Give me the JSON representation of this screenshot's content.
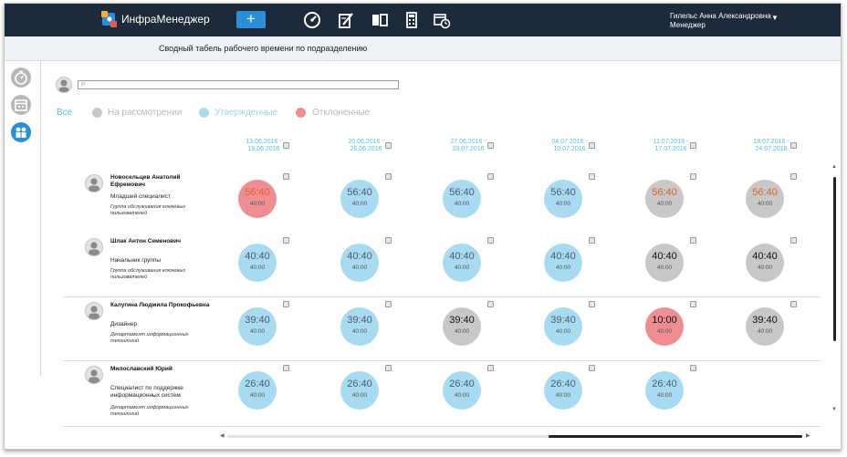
{
  "app": {
    "logo_text": "ИнфраМенеджер"
  },
  "header": {
    "add_label": "+",
    "nav_icons": [
      "dashboard-gauge-icon",
      "document-edit-icon",
      "book-icon",
      "calculator-icon",
      "calendar-clock-icon"
    ],
    "user": {
      "name": "Гилельс Анна Александровна",
      "role": "Менеджер",
      "caret": "▼"
    }
  },
  "page": {
    "title": "Сводный табель рабочего времени по подразделению"
  },
  "sidebar": {
    "icons": [
      "timer-icon",
      "calendar-icon",
      "team-icon"
    ]
  },
  "search": {
    "value": "P"
  },
  "filters": [
    {
      "label": "Все",
      "color": "#5bbde4"
    },
    {
      "label": "На рассмотрении",
      "color": "#c8c8c8"
    },
    {
      "label": "Утвержденные",
      "color": "#a8dbf2"
    },
    {
      "label": "Отклоненные",
      "color": "#ee8e93"
    }
  ],
  "periods": [
    {
      "start": "13.06.2016 -",
      "end": "19.06.2016"
    },
    {
      "start": "20.06.2016 -",
      "end": "26.06.2016"
    },
    {
      "start": "27.06.2016 -",
      "end": "03.07.2016"
    },
    {
      "start": "04.07.2016 -",
      "end": "10.07.2016"
    },
    {
      "start": "11.07.2016 -",
      "end": "17.07.2016"
    },
    {
      "start": "18.07.2016 -",
      "end": "24.07.2016"
    }
  ],
  "status_colors": {
    "approved": "#a8dbf2",
    "rejected": "#ee8e93",
    "pending": "#c8c8c8",
    "accent": "#5bbde4",
    "topbar": "#1d2a3a",
    "overtime_text": "#e0622a"
  },
  "employees": [
    {
      "name": "Новосельцев Анатолий Ефремович",
      "position": "Младший специалист",
      "department": "Группа обслуживания ключевых пользователей",
      "cells": [
        {
          "fact": "56:40",
          "plan": "40:00",
          "status": "rejected",
          "overtime": true
        },
        {
          "fact": "56:40",
          "plan": "40:00",
          "status": "approved",
          "overtime": false
        },
        {
          "fact": "56:40",
          "plan": "40:00",
          "status": "approved",
          "overtime": false
        },
        {
          "fact": "56:40",
          "plan": "40:00",
          "status": "approved",
          "overtime": false
        },
        {
          "fact": "56:40",
          "plan": "40:00",
          "status": "pending",
          "overtime": true
        },
        {
          "fact": "56:40",
          "plan": "40:00",
          "status": "pending",
          "overtime": true
        }
      ]
    },
    {
      "name": "Шлак Антон Семенович",
      "position": "Начальник группы",
      "department": "Группа обслуживания ключевых пользователей",
      "cells": [
        {
          "fact": "40:40",
          "plan": "40:00",
          "status": "approved",
          "overtime": false
        },
        {
          "fact": "40:40",
          "plan": "40:00",
          "status": "approved",
          "overtime": false
        },
        {
          "fact": "40:40",
          "plan": "40:00",
          "status": "approved",
          "overtime": false
        },
        {
          "fact": "40:40",
          "plan": "40:00",
          "status": "approved",
          "overtime": false
        },
        {
          "fact": "40:40",
          "plan": "40:00",
          "status": "pending",
          "overtime": false
        },
        {
          "fact": "40:40",
          "plan": "40:00",
          "status": "pending",
          "overtime": false
        }
      ]
    },
    {
      "name": "Калугина Людмила Прокофьевна",
      "position": "Дизайнер",
      "department": "Департамент информационных технологий",
      "cells": [
        {
          "fact": "39:40",
          "plan": "40:00",
          "status": "approved",
          "overtime": false
        },
        {
          "fact": "39:40",
          "plan": "40:00",
          "status": "approved",
          "overtime": false
        },
        {
          "fact": "39:40",
          "plan": "40:00",
          "status": "pending",
          "overtime": false
        },
        {
          "fact": "39:40",
          "plan": "40:00",
          "status": "approved",
          "overtime": false
        },
        {
          "fact": "10:00",
          "plan": "40:00",
          "status": "rejected",
          "overtime": false
        },
        {
          "fact": "39:40",
          "plan": "40:00",
          "status": "pending",
          "overtime": false
        }
      ]
    },
    {
      "name": "Милославский Юрий",
      "position": "Специалист по поддержке информационных систем",
      "department": "Департамент информационных технологий",
      "cells": [
        {
          "fact": "26:40",
          "plan": "40:00",
          "status": "approved",
          "overtime": false
        },
        {
          "fact": "26:40",
          "plan": "40:00",
          "status": "approved",
          "overtime": false
        },
        {
          "fact": "26:40",
          "plan": "40:00",
          "status": "approved",
          "overtime": false
        },
        {
          "fact": "26:40",
          "plan": "40:00",
          "status": "approved",
          "overtime": false
        },
        {
          "fact": "26:40",
          "plan": "40:00",
          "status": "approved",
          "overtime": false
        }
      ]
    }
  ]
}
